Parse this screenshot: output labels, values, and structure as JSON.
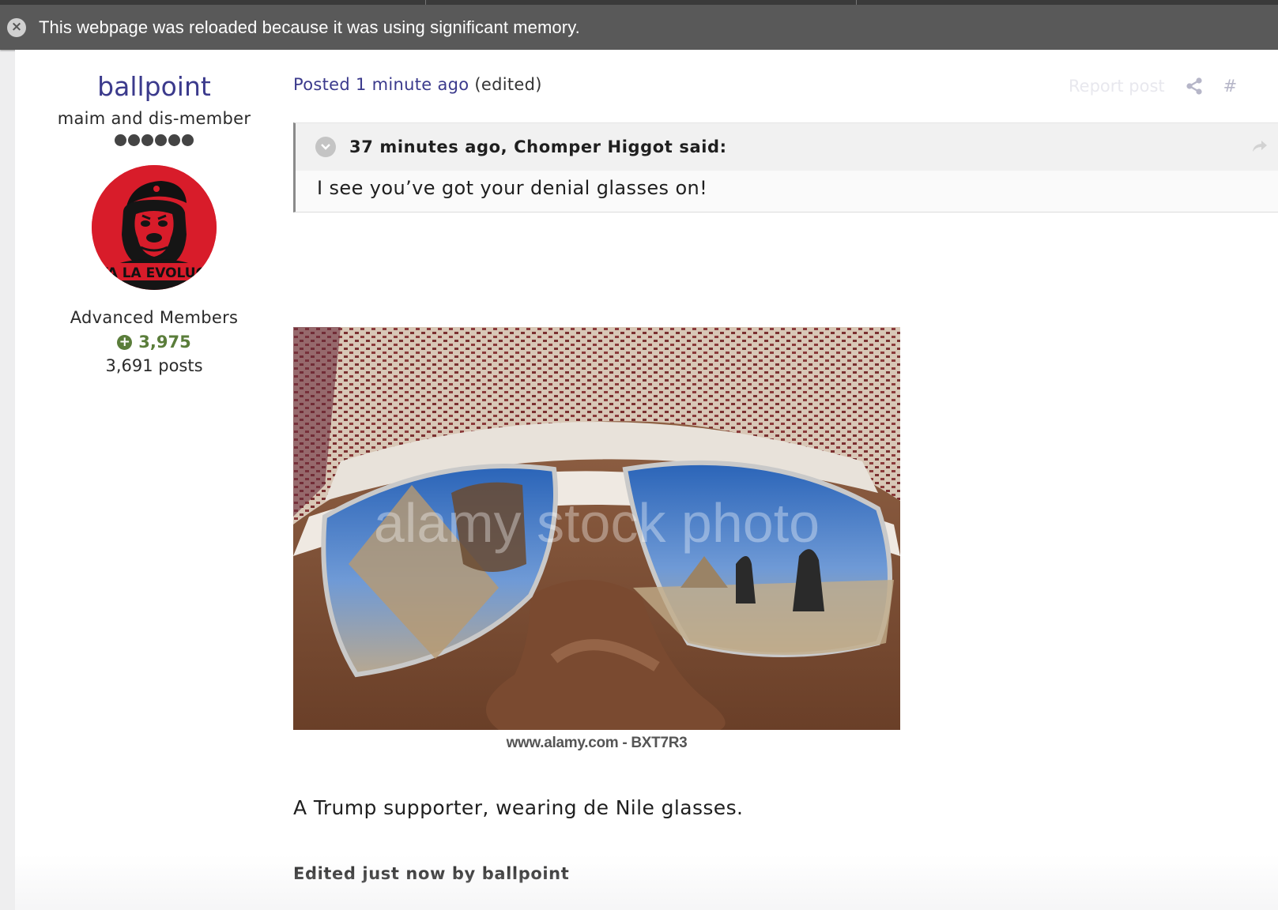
{
  "banner": {
    "message": "This webpage was reloaded because it was using significant memory.",
    "close_glyph": "×"
  },
  "author": {
    "name": "ballpoint",
    "member_title": "maim and dis-member",
    "pip_count": 6,
    "avatar_text": "VA LA EVOLUCI",
    "group": "Advanced Members",
    "reputation": "3,975",
    "posts": "3,691 posts"
  },
  "post": {
    "posted": "Posted 1 minute ago",
    "edited_tag": "(edited)",
    "report_label": "Report post",
    "share_icon": "share-icon",
    "permalink_label": "#",
    "quote": {
      "citation": "37 minutes ago, Chomper Higgot said:",
      "text": "I see you’ve got your denial glasses on!"
    },
    "image": {
      "watermark": "alamy stock photo",
      "caption": "www.alamy.com - BXT7R3"
    },
    "text": "A Trump supporter, wearing de Nile glasses.",
    "edited_note": "Edited just now by ballpoint"
  },
  "colors": {
    "accent": "#3b3a8c",
    "reputation": "#5a7d3a",
    "avatar_bg": "#d81c2a",
    "banner_bg": "#595959"
  }
}
